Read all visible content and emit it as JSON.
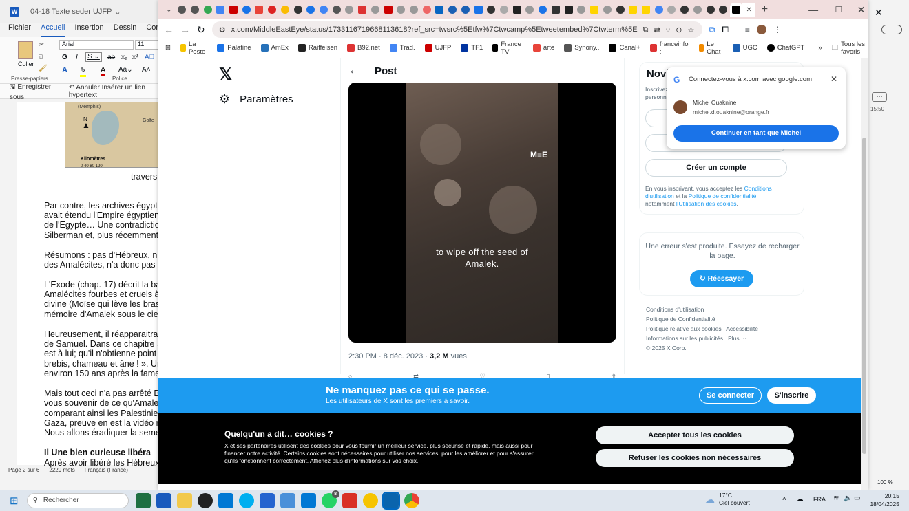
{
  "word": {
    "doc_title": "04-18 Texte seder UJFP",
    "menus": [
      "Fichier",
      "Accueil",
      "Insertion",
      "Dessin",
      "Conception"
    ],
    "active_menu": "Accueil",
    "font_name": "Arial",
    "font_size": "11",
    "coller_label": "Coller",
    "presse_papiers_label": "Presse-papiers",
    "police_label": "Police",
    "save_as_label": "Enregistrer sous",
    "undo_label": "Annuler Insérer un lien hypertext",
    "map_memphis": "(Memphis)",
    "map_golfe": "Golfe",
    "map_north": "N",
    "map_km_label": "Kilomètres",
    "map_scale": "0    40    80    120",
    "caption": "travers",
    "lines": [
      "Par contre, les archives égypti",
      "avait étendu l'Empire égyptien",
      "de l'Egypte… Une contradictio",
      "Silberman et, plus récemment",
      "Résumons : pas d'Hébreux, ni",
      "des Amalécites, n'a donc pas",
      "L'Exode (chap. 17) décrit la ba",
      "Amalécites fourbes et cruels à",
      "divine (Moïse qui lève les bras",
      "mémoire d'Amalek sous le cie",
      "Heureusement, il réapparaitra",
      "de Samuel. Dans ce chapitre S",
      "est à lui; qu'il n'obtienne point",
      "brebis, chameau et âne ! ». Ur",
      "environ 150 ans après la fame",
      "Mais tout ceci n'a pas arrêté B",
      "vous souvenir de ce qu'Amale",
      "comparant ainsi les Palestinie",
      "Gaza, preuve en est la vidéo r",
      "Nous allons éradiquer la seme",
      "Il Une bien curieuse libéra",
      "Après avoir libéré les Hébreux"
    ],
    "status_page": "Page 2 sur 6",
    "status_words": "2229 mots",
    "status_lang": "Français (France)"
  },
  "chrome": {
    "url": "x.com/MiddleEastEye/status/1733116719668113618?ref_src=twsrc%5Etfw%7Ctwcamp%5Etweetembed%7Ctwterm%5E1733116719668113618%7Ctwgr%5Ec48...",
    "bookmarks": [
      "La Poste",
      "Palatine",
      "AmEx",
      "Raiffeisen",
      "B92.net",
      "Trad.",
      "UJFP",
      "TF1",
      "France TV",
      "arte",
      "Synony..",
      "Canal+",
      "franceinfo :",
      "Le Chat",
      "UGC",
      "ChatGPT"
    ],
    "bookmark_colors": [
      "#f6c400",
      "#1a73e8",
      "#2671b9",
      "#222222",
      "#d33",
      "#4285f4",
      "#c00",
      "#0033a0",
      "#000",
      "#e8443a",
      "#555",
      "#000",
      "#d33",
      "#f28b00",
      "#1a5fb4",
      "#000"
    ],
    "all_bookmarks": "Tous les favoris"
  },
  "x": {
    "nav_settings": "Paramètres",
    "post_title": "Post",
    "video_caption_1": "to wipe off the seed of",
    "video_caption_2": "Amalek.",
    "video_logo": "M≡E",
    "post_time": "2:30 PM · 8 déc. 2023 · ",
    "post_views_num": "3,2 M",
    "post_views_label": " vues",
    "signup_title": "Novi",
    "signup_sub_1": "Inscrivez",
    "signup_sub_2": "personna",
    "create_account": "Créer un compte",
    "terms": [
      "En vous inscrivant, vous acceptez les ",
      "Conditions d'utilisation",
      " et la ",
      "Politique de confidentialité",
      ",",
      "notamment ",
      "l'Utilisation des cookies",
      "."
    ],
    "error_text": "Une erreur s'est produite. Essayez de recharger la page.",
    "retry": "Réessayer",
    "footer_1": "Conditions d'utilisation",
    "footer_2": "Politique de Confidentialité",
    "footer_3": "Politique relative aux cookies",
    "footer_4": "Accessibilité",
    "footer_5": "Informations sur les publicités",
    "footer_6": "Plus ···",
    "footer_7": "© 2025 X Corp.",
    "google_title": "Connectez-vous à x.com avec google.com",
    "google_name": "Michel Ouaknine",
    "google_email": "michel.d.ouaknine@orange.fr",
    "google_continue": "Continuer en tant que Michel",
    "banner_title": "Ne manquez pas ce qui se passe.",
    "banner_sub": "Les utilisateurs de X sont les premiers à savoir.",
    "login": "Se connecter",
    "signup": "S'inscrire",
    "cookie_title": "Quelqu'un a dit… cookies ?",
    "cookie_text": "X et ses partenaires utilisent des cookies pour vous fournir un meilleur service, plus sécurisé et rapide, mais aussi pour financer notre activité. Certains cookies sont nécessaires pour utiliser nos services, pour les améliorer et pour s'assurer qu'ils fonctionnent correctement. ",
    "cookie_link": "Affichez plus d'informations sur vos choix",
    "accept_cookies": "Accepter tous les cookies",
    "refuse_cookies": "Refuser les cookies non nécessaires"
  },
  "right_window": {
    "time": "15:50",
    "zoom": "100 %"
  },
  "taskbar": {
    "search": "Rechercher",
    "badge": "8",
    "weather_temp": "17°C",
    "weather_desc": "Ciel couvert",
    "lang": "FRA",
    "time": "20:15",
    "date": "18/04/2025"
  }
}
